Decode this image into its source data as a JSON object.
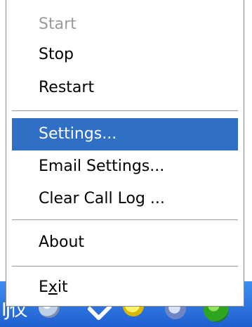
{
  "menu": {
    "start": "Start",
    "stop": "Stop",
    "restart": "Restart",
    "settings": "Settings...",
    "email_settings": "Email Settings...",
    "clear_call_log": "Clear Call Log ...",
    "about": "About",
    "exit_prefix": "E",
    "exit_mnemonic": "x",
    "exit_suffix": "it"
  },
  "taskbar": {
    "tray_text": "IJ仅"
  },
  "colors": {
    "selection": "#2f6fc6",
    "disabled_text": "#9a9a9a",
    "taskbar": "#1f5fd0"
  },
  "icons": [
    "tray-app-icon",
    "tray-check-icon",
    "tray-yellow-icon",
    "tray-network-icon",
    "tray-green-icon"
  ]
}
